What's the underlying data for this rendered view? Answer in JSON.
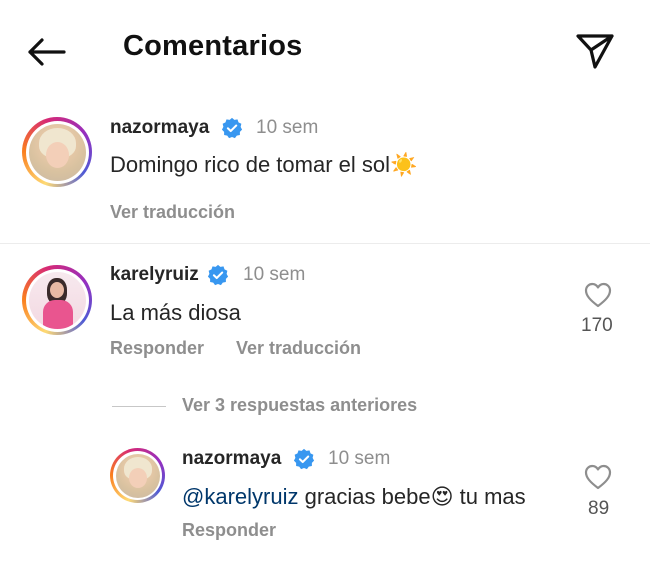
{
  "header": {
    "title": "Comentarios",
    "back_icon": "arrow-left-icon",
    "share_icon": "paper-plane-icon"
  },
  "caption": {
    "username": "nazormaya",
    "verified": true,
    "time": "10 sem",
    "text": "Domingo rico de tomar el sol",
    "emoji": "☀️",
    "translate_label": "Ver traducción"
  },
  "comment": {
    "username": "karelyruiz",
    "verified": true,
    "time": "10 sem",
    "text": "La más diosa",
    "reply_label": "Responder",
    "translate_label": "Ver traducción",
    "likes": "170"
  },
  "replies_toggle": {
    "label": "Ver 3 respuestas anteriores"
  },
  "reply": {
    "username": "nazormaya",
    "verified": true,
    "time": "10 sem",
    "mention": "@karelyruiz",
    "text_before_emoji": " gracias bebe",
    "emoji": "😍",
    "text_after_emoji": " tu mas",
    "reply_label": "Responder",
    "likes": "89"
  },
  "colors": {
    "verified_blue": "#3897f0",
    "muted_text": "#8e8e8e",
    "mention_blue": "#00376b",
    "story_ring": [
      "#feda75",
      "#fa7e1e",
      "#d62976",
      "#962fbf",
      "#4f5bd5"
    ]
  }
}
